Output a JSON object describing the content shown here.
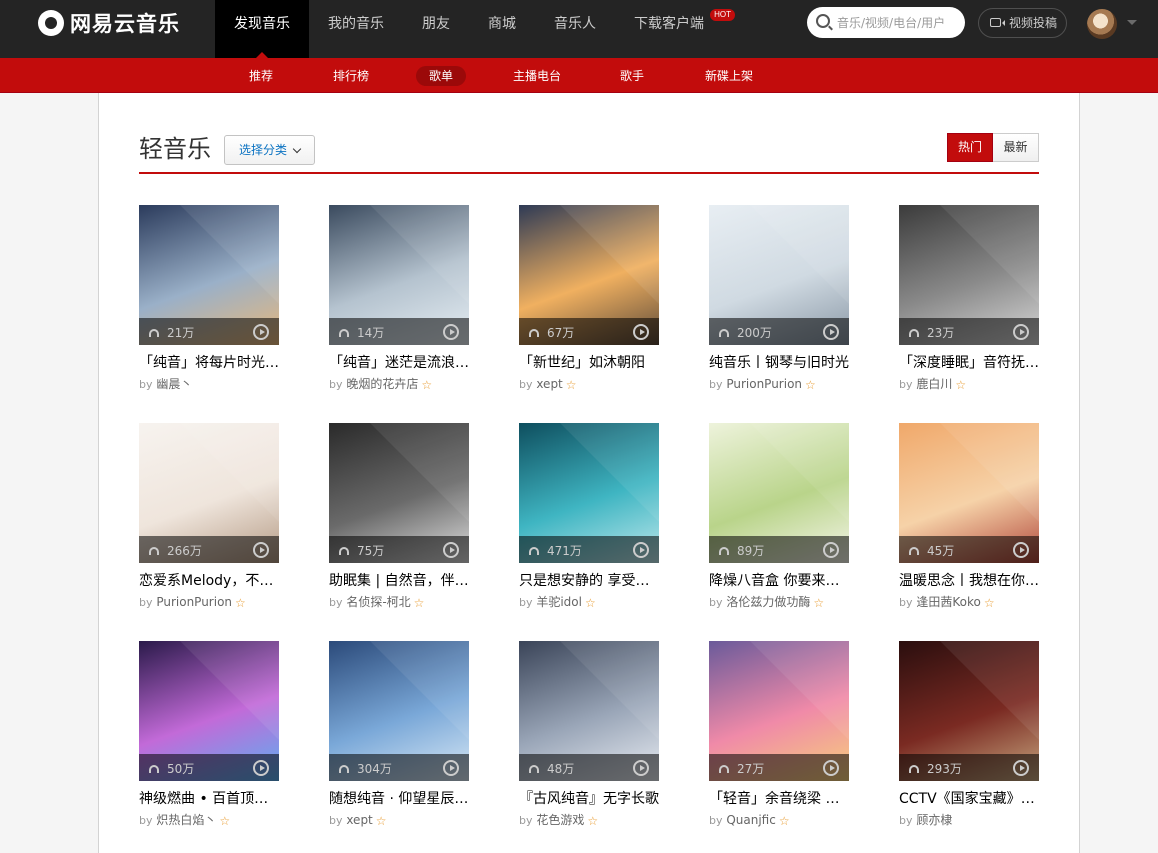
{
  "header": {
    "logo_text": "网易云音乐",
    "nav": [
      {
        "label": "发现音乐",
        "active": true
      },
      {
        "label": "我的音乐"
      },
      {
        "label": "朋友"
      },
      {
        "label": "商城"
      },
      {
        "label": "音乐人"
      },
      {
        "label": "下载客户端",
        "badge": "HOT"
      }
    ],
    "search_placeholder": "音乐/视频/电台/用户",
    "video_button": "视频投稿"
  },
  "subnav": [
    {
      "label": "推荐"
    },
    {
      "label": "排行榜"
    },
    {
      "label": "歌单",
      "active": true
    },
    {
      "label": "主播电台"
    },
    {
      "label": "歌手"
    },
    {
      "label": "新碟上架"
    }
  ],
  "section": {
    "title": "轻音乐",
    "category_button": "选择分类",
    "sort_hot": "热门",
    "sort_new": "最新"
  },
  "by_prefix": "by",
  "colors": {
    "brand_red": "#c20c0c",
    "topbar": "#242424",
    "star": "#e89b2f"
  },
  "playlists": [
    {
      "count": "21万",
      "title": "「纯音」将每片时光都折成纸飞机",
      "author": "幽晨丶",
      "star": false,
      "colors": [
        "#2b3b5c",
        "#9ab0c8",
        "#e8b87a"
      ]
    },
    {
      "count": "14万",
      "title": "「纯音」迷茫是流浪的孤独",
      "author": "晚烟的花卉店",
      "star": true,
      "colors": [
        "#3a4a5e",
        "#b5c3cf",
        "#e6eef3"
      ]
    },
    {
      "count": "67万",
      "title": "「新世纪」如沐朝阳",
      "author": "xept",
      "star": true,
      "colors": [
        "#2e3a55",
        "#f0b060",
        "#5c4a3a"
      ]
    },
    {
      "count": "200万",
      "title": "纯音乐丨钢琴与旧时光",
      "author": "PurionPurion",
      "star": true,
      "colors": [
        "#e8eef3",
        "#d0dae2",
        "#8a98a6"
      ]
    },
    {
      "count": "23万",
      "title": "「深度睡眠」音符抚平心灵",
      "author": "鹿白川",
      "star": true,
      "colors": [
        "#3b3b3b",
        "#8a8a8a",
        "#d8d8d8"
      ]
    },
    {
      "count": "266万",
      "title": "恋爱系Melody，不要忘记",
      "author": "PurionPurion",
      "star": true,
      "colors": [
        "#f7f3ef",
        "#efe5dc",
        "#b49a84"
      ]
    },
    {
      "count": "75万",
      "title": "助眠集 | 自然音，伴你入眠",
      "author": "名侦探-柯北",
      "star": true,
      "colors": [
        "#2a2a2a",
        "#6a6a6a",
        "#e0e0e0"
      ]
    },
    {
      "count": "471万",
      "title": "只是想安静的 享受一个人",
      "author": "羊驼idol",
      "star": true,
      "colors": [
        "#0e4e5e",
        "#3fb5c2",
        "#bfe8ec"
      ]
    },
    {
      "count": "89万",
      "title": "降燥八音盒 你要来一首吗",
      "author": "洛伦兹力做功酶",
      "star": true,
      "colors": [
        "#eef3dc",
        "#b9d48a",
        "#f5f5ea"
      ]
    },
    {
      "count": "45万",
      "title": "温暖思念丨我想在你身边",
      "author": "逢田茜Koko",
      "star": true,
      "colors": [
        "#f0a86a",
        "#f6d2a8",
        "#b0463a"
      ]
    },
    {
      "count": "50万",
      "title": "神级燃曲 • 百首顶级纯音",
      "author": "炽热白焰丶",
      "star": true,
      "colors": [
        "#2a1a4a",
        "#c26ad8",
        "#5ab0f0"
      ]
    },
    {
      "count": "304万",
      "title": "随想纯音 · 仰望星辰大海",
      "author": "xept",
      "star": true,
      "colors": [
        "#2b4a7a",
        "#7aa8d8",
        "#d8e8f5"
      ]
    },
    {
      "count": "48万",
      "title": "『古风纯音』无字长歌",
      "author": "花色游戏",
      "star": true,
      "colors": [
        "#3a4458",
        "#9aa6b8",
        "#e8ecf2"
      ]
    },
    {
      "count": "27万",
      "title": "「轻音」余音绕梁 三日不绝",
      "author": "Quanjfic",
      "star": true,
      "colors": [
        "#6a5a9a",
        "#f08aa8",
        "#f6d07a"
      ]
    },
    {
      "count": "293万",
      "title": "CCTV《国家宝藏》|纯音乐",
      "author": "顾亦棣",
      "star": false,
      "colors": [
        "#2a0e0e",
        "#7a2a22",
        "#c8a880"
      ]
    }
  ]
}
